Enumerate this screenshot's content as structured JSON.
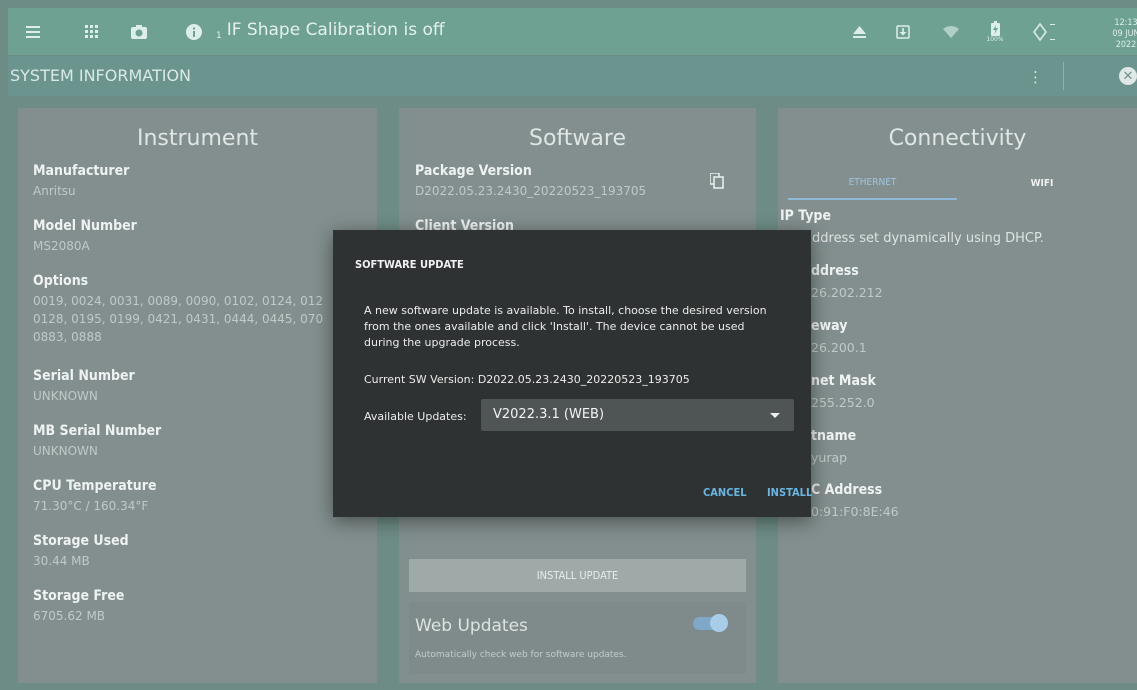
{
  "topbar": {
    "icons": [
      "menu-icon",
      "apps-grid-icon",
      "camera-icon",
      "info-icon",
      "eject-icon",
      "download-icon",
      "wifi-icon",
      "battery-icon",
      "gps-icon"
    ],
    "info_subscript": "1",
    "title": "IF Shape Calibration is off",
    "battery_percent": "100%",
    "time": "12:13",
    "date": "09 JUN 2022"
  },
  "header": {
    "title": "SYSTEM INFORMATION"
  },
  "instrument": {
    "title": "Instrument",
    "fields": [
      {
        "label": "Manufacturer",
        "value": "Anritsu"
      },
      {
        "label": "Model Number",
        "value": "MS2080A"
      },
      {
        "label": "Options",
        "value_lines": [
          "0019, 0024, 0031, 0089, 0090, 0102, 0124, 012",
          "0128, 0195, 0199, 0421, 0431, 0444, 0445, 070",
          "0883, 0888"
        ]
      },
      {
        "label": "Serial Number",
        "value": "UNKNOWN"
      },
      {
        "label": "MB Serial Number",
        "value": "UNKNOWN"
      },
      {
        "label": "CPU Temperature",
        "value": "71.30°C / 160.34°F"
      },
      {
        "label": "Storage Used",
        "value": "30.44 MB"
      },
      {
        "label": "Storage Free",
        "value": "6705.62 MB"
      }
    ]
  },
  "software": {
    "title": "Software",
    "package_label": "Package Version",
    "package_value": "D2022.05.23.2430_20220523_193705",
    "client_label": "Client Version",
    "install_update_label": "INSTALL UPDATE",
    "web_updates_label": "Web Updates",
    "web_updates_desc": "Automatically check web for software updates.",
    "web_updates_enabled": true
  },
  "connectivity": {
    "title": "Connectivity",
    "tabs": [
      "ETHERNET",
      "WIFI"
    ],
    "active_tab": "ETHERNET",
    "fields": [
      {
        "label": "IP Type",
        "value": "ddress set dynamically using DHCP."
      },
      {
        "label": "ddress",
        "value": "26.202.212"
      },
      {
        "label": "eway",
        "value": "26.200.1"
      },
      {
        "label": "net Mask",
        "value": "255.252.0"
      },
      {
        "label": "tname",
        "value": "yurap"
      },
      {
        "label": "C Address",
        "value": "0:91:F0:8E:46"
      }
    ]
  },
  "dialog": {
    "title": "SOFTWARE UPDATE",
    "message": "A new software update is available. To install, choose the desired version from the ones available and click 'Install'. The device cannot be used during the upgrade process.",
    "current_version": "Current SW Version: D2022.05.23.2430_20220523_193705",
    "available_label": "Available Updates:",
    "selected_update": "V2022.3.1 (WEB)",
    "cancel_label": "CANCEL",
    "install_label": "INSTALL"
  },
  "colors": {
    "topbar": "#6fa193",
    "panel": "#828f8e",
    "dialog": "#2f3232",
    "accent": "#69b6e3"
  }
}
